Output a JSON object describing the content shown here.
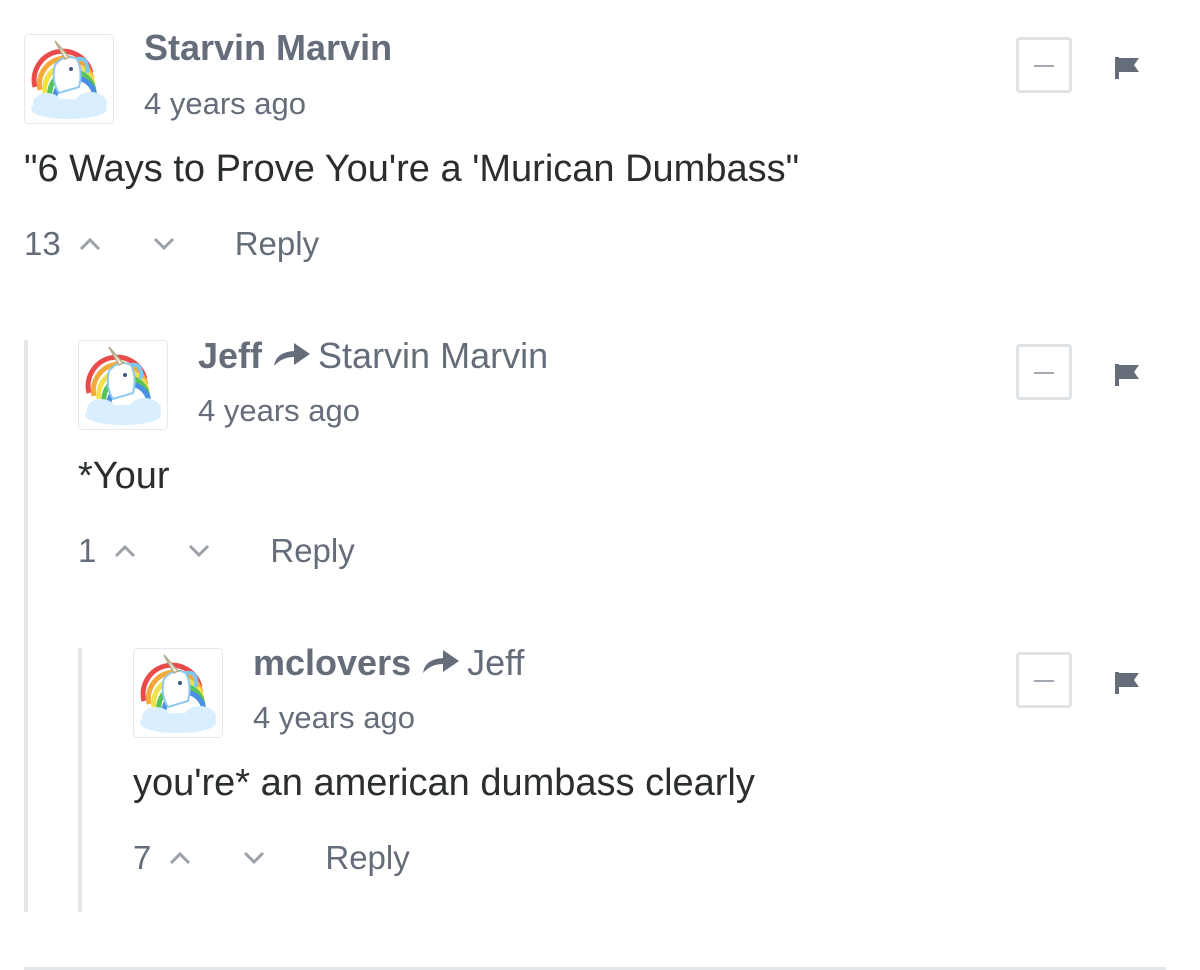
{
  "comments": [
    {
      "author": "Starvin Marvin",
      "reply_to": "",
      "timestamp": "4 years ago",
      "text": "\"6 Ways to Prove You're a 'Murican Dumbass\"",
      "votes": "13",
      "reply_label": "Reply"
    },
    {
      "author": "Jeff",
      "reply_to": "Starvin Marvin",
      "timestamp": "4 years ago",
      "text": "*Your",
      "votes": "1",
      "reply_label": "Reply"
    },
    {
      "author": "mclovers",
      "reply_to": "Jeff",
      "timestamp": "4 years ago",
      "text": "you're* an american dumbass clearly",
      "votes": "7",
      "reply_label": "Reply"
    }
  ],
  "colors": {
    "meta_text": "#656c7a",
    "body_text": "#2a2e2e",
    "thread_line": "#e3e7ea"
  },
  "icons": [
    "unicorn-avatar-icon",
    "reply-arrow-icon",
    "upvote-chevron-icon",
    "downvote-chevron-icon",
    "collapse-minus-icon",
    "flag-icon"
  ]
}
